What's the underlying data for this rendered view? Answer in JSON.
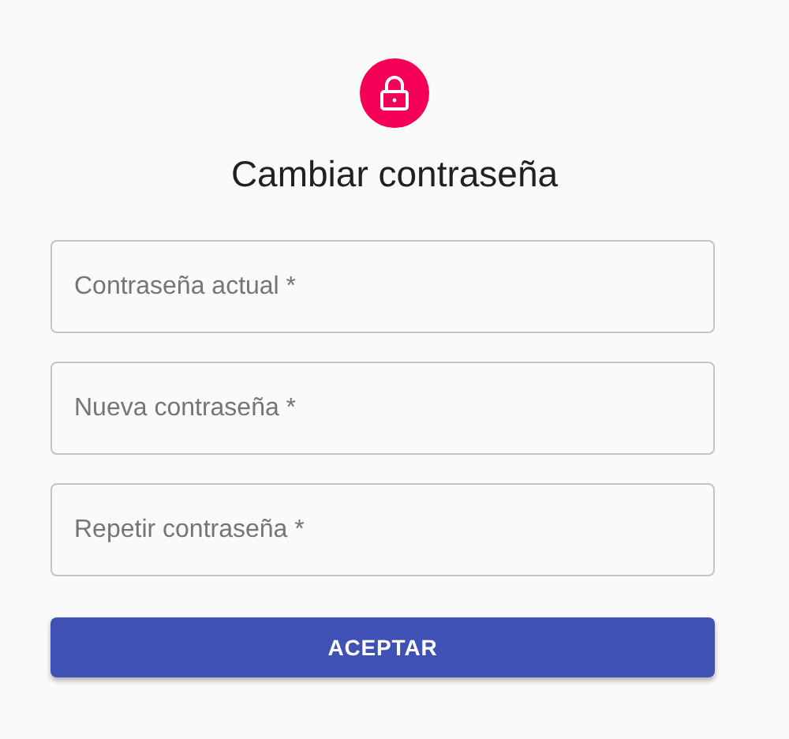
{
  "title": "Cambiar contraseña",
  "fields": [
    {
      "placeholder": "Contraseña actual *"
    },
    {
      "placeholder": "Nueva contraseña *"
    },
    {
      "placeholder": "Repetir contraseña *"
    }
  ],
  "submit": "ACEPTAR"
}
